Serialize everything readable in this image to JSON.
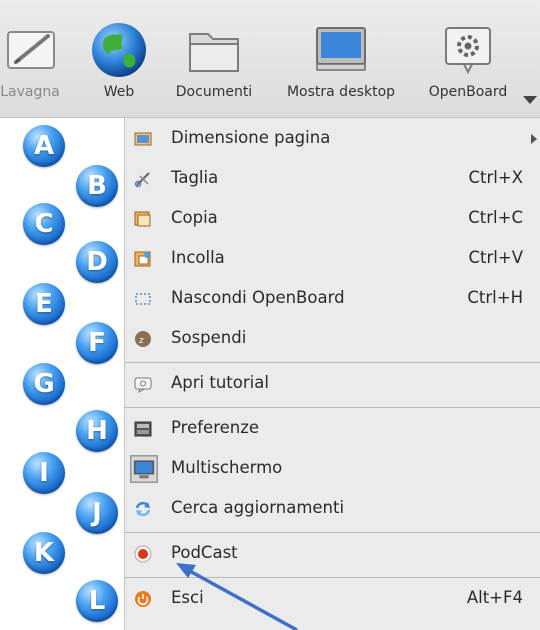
{
  "toolbar": {
    "items": [
      {
        "label": "Lavagna",
        "icon": "pen-board-icon"
      },
      {
        "label": "Web",
        "icon": "globe-icon"
      },
      {
        "label": "Documenti",
        "icon": "folder-icon"
      },
      {
        "label": "Mostra desktop",
        "icon": "monitor-icon"
      },
      {
        "label": "OpenBoard",
        "icon": "openboard-gear-icon"
      }
    ]
  },
  "menu": {
    "items": [
      {
        "label": "Dimensione pagina",
        "shortcut": "",
        "submenu": true,
        "icon": "page-size-icon"
      },
      {
        "label": "Taglia",
        "shortcut": "Ctrl+X",
        "icon": "scissors-icon"
      },
      {
        "label": "Copia",
        "shortcut": "Ctrl+C",
        "icon": "copy-icon"
      },
      {
        "label": "Incolla",
        "shortcut": "Ctrl+V",
        "icon": "paste-icon"
      },
      {
        "label": "Nascondi OpenBoard",
        "shortcut": "Ctrl+H",
        "icon": "hide-icon"
      },
      {
        "label": "Sospendi",
        "shortcut": "",
        "icon": "sleep-icon"
      },
      {
        "label": "Apri tutorial",
        "shortcut": "",
        "icon": "tutorial-icon"
      },
      {
        "label": "Preferenze",
        "shortcut": "",
        "icon": "preferences-icon"
      },
      {
        "label": "Multischermo",
        "shortcut": "",
        "icon": "multiscreen-icon"
      },
      {
        "label": "Cerca aggiornamenti",
        "shortcut": "",
        "icon": "update-icon"
      },
      {
        "label": "PodCast",
        "shortcut": "",
        "icon": "record-icon"
      },
      {
        "label": "Esci",
        "shortcut": "Alt+F4",
        "icon": "power-icon"
      }
    ]
  },
  "badges": [
    "A",
    "B",
    "C",
    "D",
    "E",
    "F",
    "G",
    "H",
    "I",
    "J",
    "K",
    "L"
  ],
  "colors": {
    "badge_blue": "#1a6fd6",
    "arrow_blue": "#3f6fc6",
    "record_red": "#d9351c",
    "power_orange": "#ea7a1c"
  }
}
